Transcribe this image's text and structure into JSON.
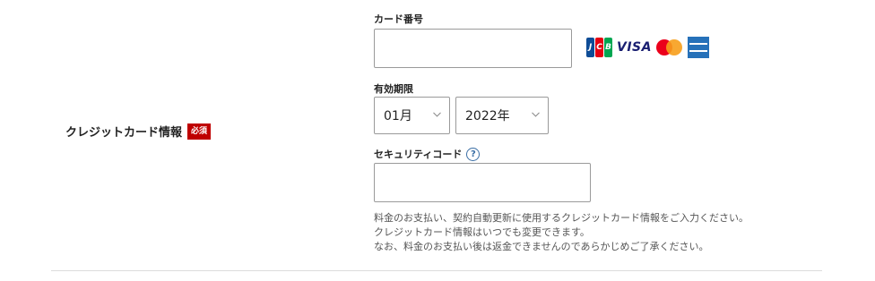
{
  "section": {
    "label": "クレジットカード情報",
    "required_badge": "必須"
  },
  "card_number": {
    "label": "カード番号",
    "value": ""
  },
  "brands": {
    "jcb_letters": [
      "J",
      "C",
      "B"
    ],
    "jcb_colors": [
      "#0e4c96",
      "#e60012",
      "#00a651"
    ],
    "visa": "VISA",
    "mastercard_colors": [
      "#eb001b",
      "#f79e1b"
    ],
    "amex_color": "#2671b9"
  },
  "expiry": {
    "label": "有効期限",
    "month": "01月",
    "year": "2022年"
  },
  "security_code": {
    "label": "セキュリティコード",
    "help_icon": "?",
    "value": ""
  },
  "note": {
    "line1": "料金のお支払い、契約自動更新に使用するクレジットカード情報をご入力ください。",
    "line2": "クレジットカード情報はいつでも変更できます。",
    "line3": "なお、料金のお支払い後は返金できませんのであらかじめご了承ください。"
  },
  "colors": {
    "required_badge_bg": "#bf0000",
    "input_border": "#9a9a9a",
    "help_icon": "#3a6ea5",
    "divider": "#dcdcdc"
  }
}
